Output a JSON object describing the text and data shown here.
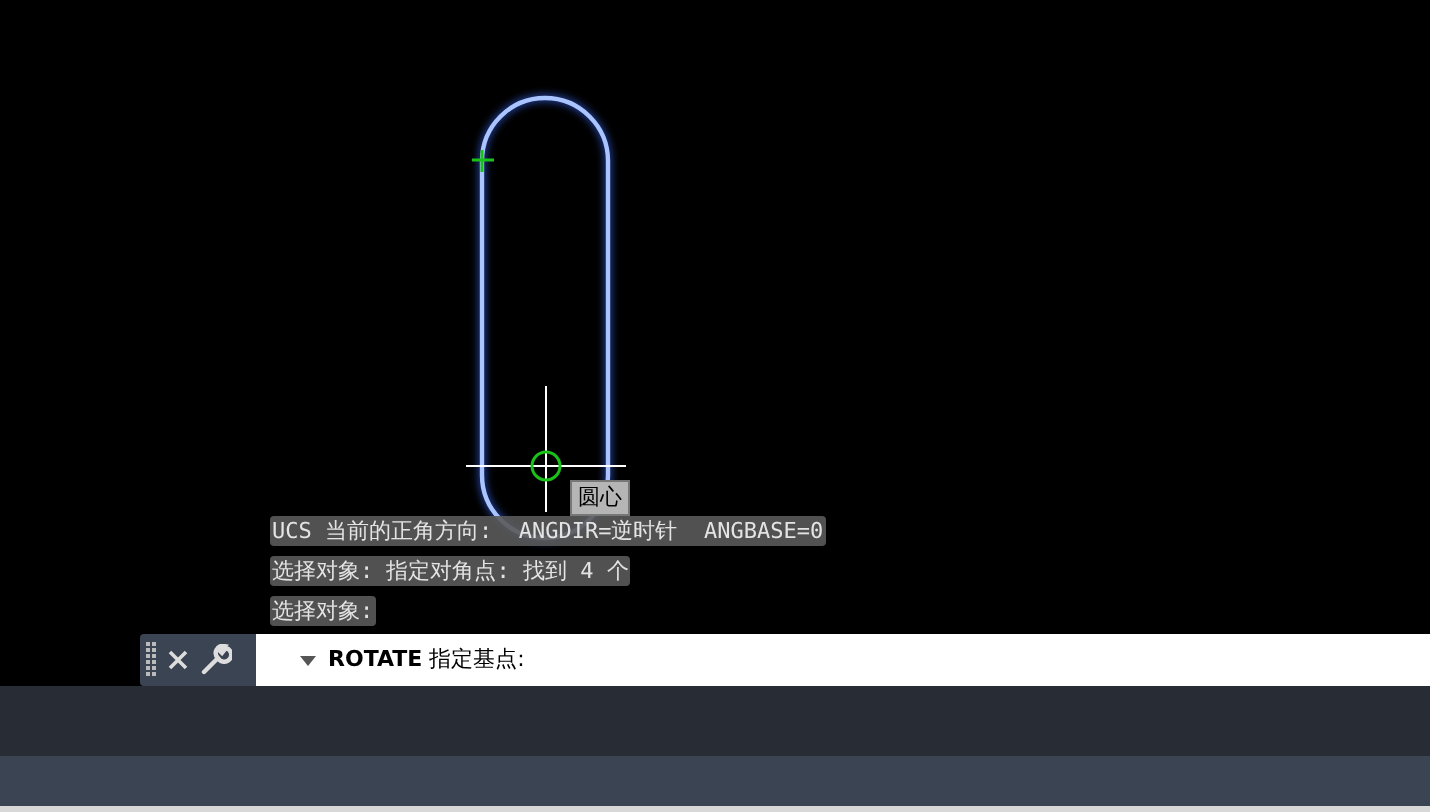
{
  "canvas": {
    "tooltip": "圆心"
  },
  "history": [
    "UCS 当前的正角方向:  ANGDIR=逆时针  ANGBASE=0",
    "选择对象: 指定对角点: 找到 4 个",
    "选择对象:"
  ],
  "command_line": {
    "prompt_command": "ROTATE",
    "prompt_text": "指定基点:"
  }
}
